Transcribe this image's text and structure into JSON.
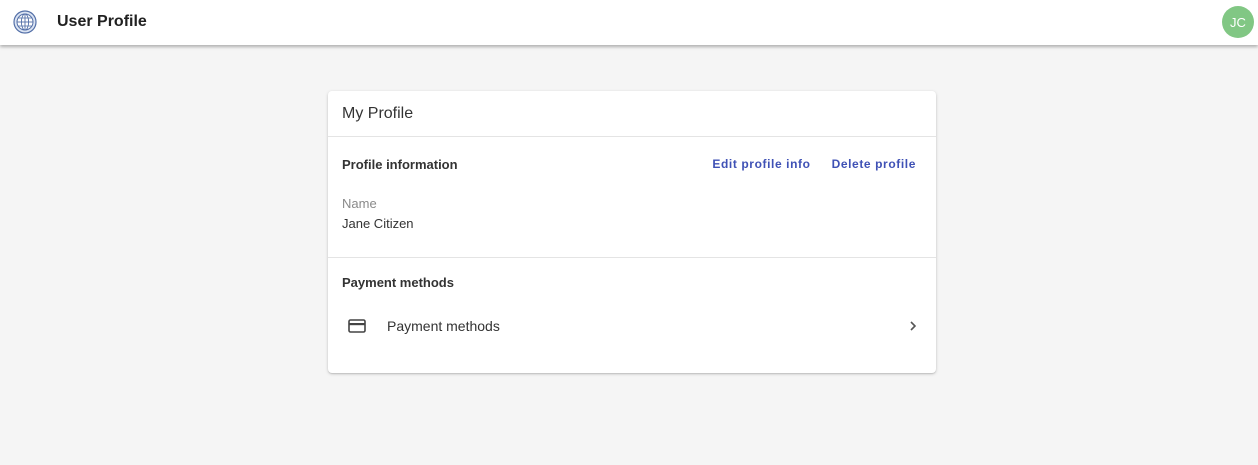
{
  "appbar": {
    "title": "User Profile",
    "logo_icon": "globe-icon",
    "avatar_initials": "JC",
    "avatar_color": "#81c784"
  },
  "card": {
    "title": "My Profile",
    "profile_section": {
      "heading": "Profile information",
      "edit_label": "Edit profile info",
      "delete_label": "Delete profile",
      "name_label": "Name",
      "name_value": "Jane Citizen"
    },
    "payment_section": {
      "heading": "Payment methods",
      "row_icon": "credit-card-icon",
      "row_label": "Payment methods",
      "row_chevron_icon": "chevron-right-icon"
    }
  },
  "colors": {
    "accent": "#3f51b5",
    "background": "#f5f5f5"
  }
}
